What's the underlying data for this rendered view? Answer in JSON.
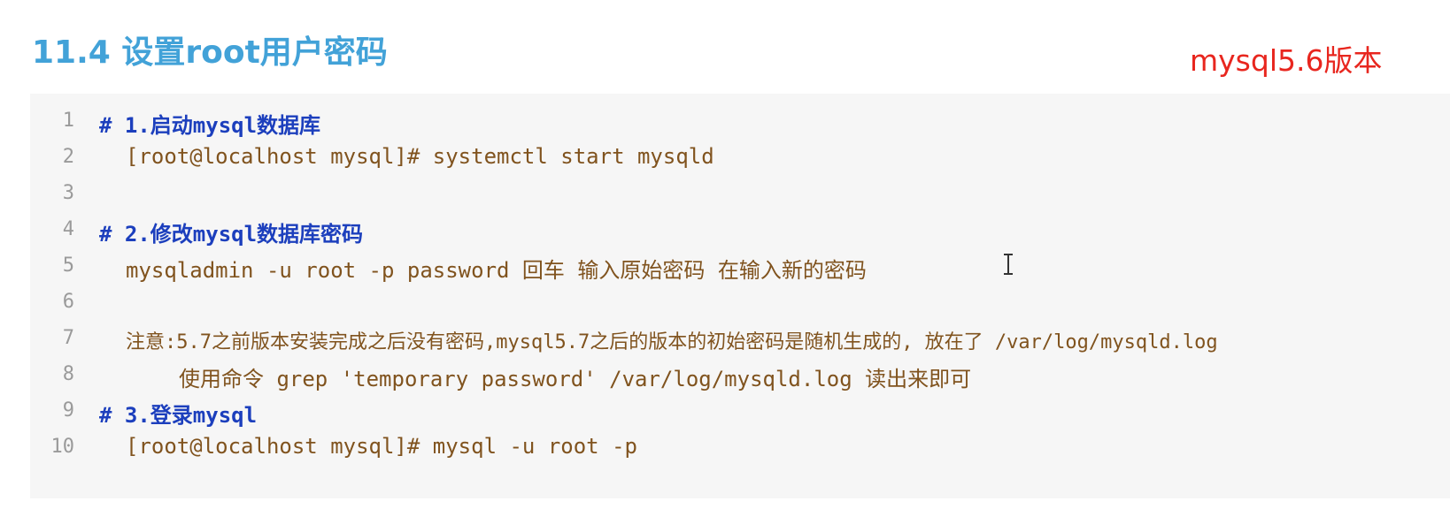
{
  "header": {
    "title": "11.4 设置root用户密码",
    "version_note": "mysql5.6版本"
  },
  "code": {
    "lines": [
      {
        "number": "1",
        "text": "# 1.启动mysql数据库"
      },
      {
        "number": "2",
        "text": "[root@localhost mysql]# systemctl start mysqld"
      },
      {
        "number": "3",
        "text": ""
      },
      {
        "number": "4",
        "text": "# 2.修改mysql数据库密码"
      },
      {
        "number": "5",
        "text": "mysqladmin -u root -p password 回车 输入原始密码 在输入新的密码"
      },
      {
        "number": "6",
        "text": ""
      },
      {
        "number": "7",
        "text": "注意:5.7之前版本安装完成之后没有密码,mysql5.7之后的版本的初始密码是随机生成的, 放在了 /var/log/mysqld.log"
      },
      {
        "number": "8",
        "text": "使用命令 grep 'temporary password' /var/log/mysqld.log 读出来即可"
      },
      {
        "number": "9",
        "text": "# 3.登录mysql"
      },
      {
        "number": "10",
        "text": "[root@localhost mysql]# mysql -u root -p"
      }
    ]
  },
  "colors": {
    "title": "#42a2d8",
    "version_note": "#e8261e",
    "comment": "#1c3fbd",
    "command": "#80531e",
    "line_number": "#9a9a9a",
    "code_background": "#f6f6f6"
  },
  "icons": {
    "cursor": "text-cursor-icon"
  }
}
